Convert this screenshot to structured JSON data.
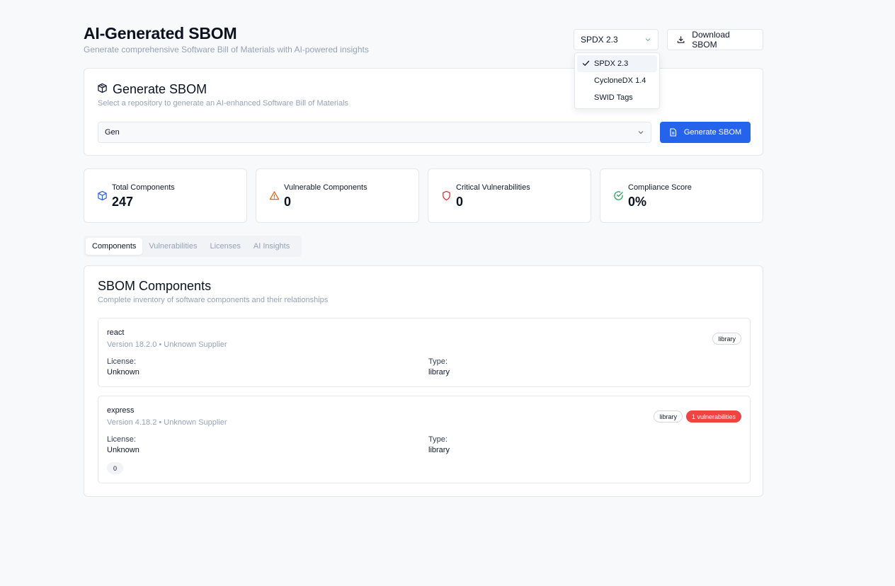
{
  "header": {
    "title": "AI-Generated SBOM",
    "subtitle": "Generate comprehensive Software Bill of Materials with AI-powered insights",
    "format_selected": "SPDX 2.3",
    "download_label": "Download SBOM"
  },
  "format_dropdown": {
    "options": [
      "SPDX 2.3",
      "CycloneDX 1.4",
      "SWID Tags"
    ],
    "selected": "SPDX 2.3"
  },
  "generate": {
    "title": "Generate SBOM",
    "description": "Select a repository to generate an AI-enhanced Software Bill of Materials",
    "repo_value": "Gen",
    "button_label": "Generate SBOM"
  },
  "stats": [
    {
      "label": "Total Components",
      "value": "247",
      "icon": "package-icon",
      "color": "#2563eb"
    },
    {
      "label": "Vulnerable Components",
      "value": "0",
      "icon": "warning-icon",
      "color": "#ea580c"
    },
    {
      "label": "Critical Vulnerabilities",
      "value": "0",
      "icon": "shield-icon",
      "color": "#dc2626"
    },
    {
      "label": "Compliance Score",
      "value": "0%",
      "icon": "check-circle-icon",
      "color": "#16a34a"
    }
  ],
  "tabs": [
    "Components",
    "Vulnerabilities",
    "Licenses",
    "AI Insights"
  ],
  "active_tab": "Components",
  "components_section": {
    "title": "SBOM Components",
    "description": "Complete inventory of software components and their relationships",
    "license_label": "License:",
    "type_label": "Type:",
    "items": [
      {
        "name": "react",
        "meta": "Version 18.2.0 • Unknown Supplier",
        "license": "Unknown",
        "type": "library",
        "badges": [
          "library"
        ]
      },
      {
        "name": "express",
        "meta": "Version 4.18.2 • Unknown Supplier",
        "license": "Unknown",
        "type": "library",
        "badges": [
          "library"
        ],
        "vuln_badge": "1 vulnerabilities",
        "count": "0"
      }
    ]
  },
  "colors": {
    "accent": "#2563eb",
    "danger": "#ef4444"
  }
}
